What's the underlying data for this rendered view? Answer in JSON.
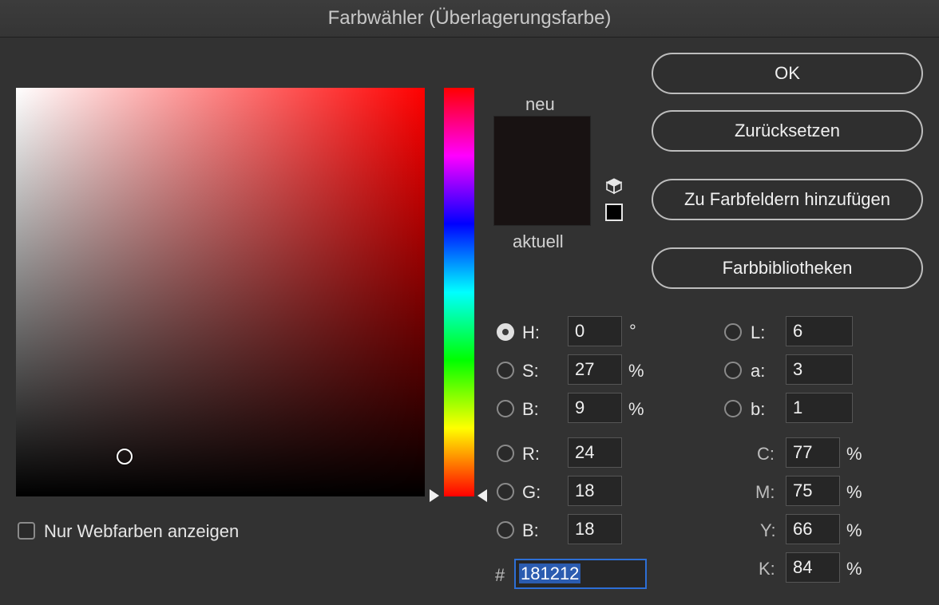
{
  "window": {
    "title": "Farbwähler (Überlagerungsfarbe)"
  },
  "colors": {
    "new": "#181212",
    "current": "#181212"
  },
  "picker": {
    "new_label": "neu",
    "current_label": "aktuell"
  },
  "buttons": {
    "ok": "OK",
    "reset": "Zurücksetzen",
    "add_swatches": "Zu Farbfeldern hinzufügen",
    "libraries": "Farbbibliotheken"
  },
  "hsb": {
    "h": {
      "label": "H:",
      "value": "0",
      "unit": "°",
      "selected": true
    },
    "s": {
      "label": "S:",
      "value": "27",
      "unit": "%"
    },
    "b": {
      "label": "B:",
      "value": "9",
      "unit": "%"
    }
  },
  "rgb": {
    "r": {
      "label": "R:",
      "value": "24"
    },
    "g": {
      "label": "G:",
      "value": "18"
    },
    "b": {
      "label": "B:",
      "value": "18"
    }
  },
  "lab": {
    "l": {
      "label": "L:",
      "value": "6"
    },
    "a": {
      "label": "a:",
      "value": "3"
    },
    "b": {
      "label": "b:",
      "value": "1"
    }
  },
  "cmyk": {
    "c": {
      "label": "C:",
      "value": "77",
      "unit": "%"
    },
    "m": {
      "label": "M:",
      "value": "75",
      "unit": "%"
    },
    "y": {
      "label": "Y:",
      "value": "66",
      "unit": "%"
    },
    "k": {
      "label": "K:",
      "value": "84",
      "unit": "%"
    }
  },
  "hex": {
    "label": "#",
    "value": "181212"
  },
  "web_only": {
    "label": "Nur Webfarben anzeigen",
    "checked": false
  }
}
